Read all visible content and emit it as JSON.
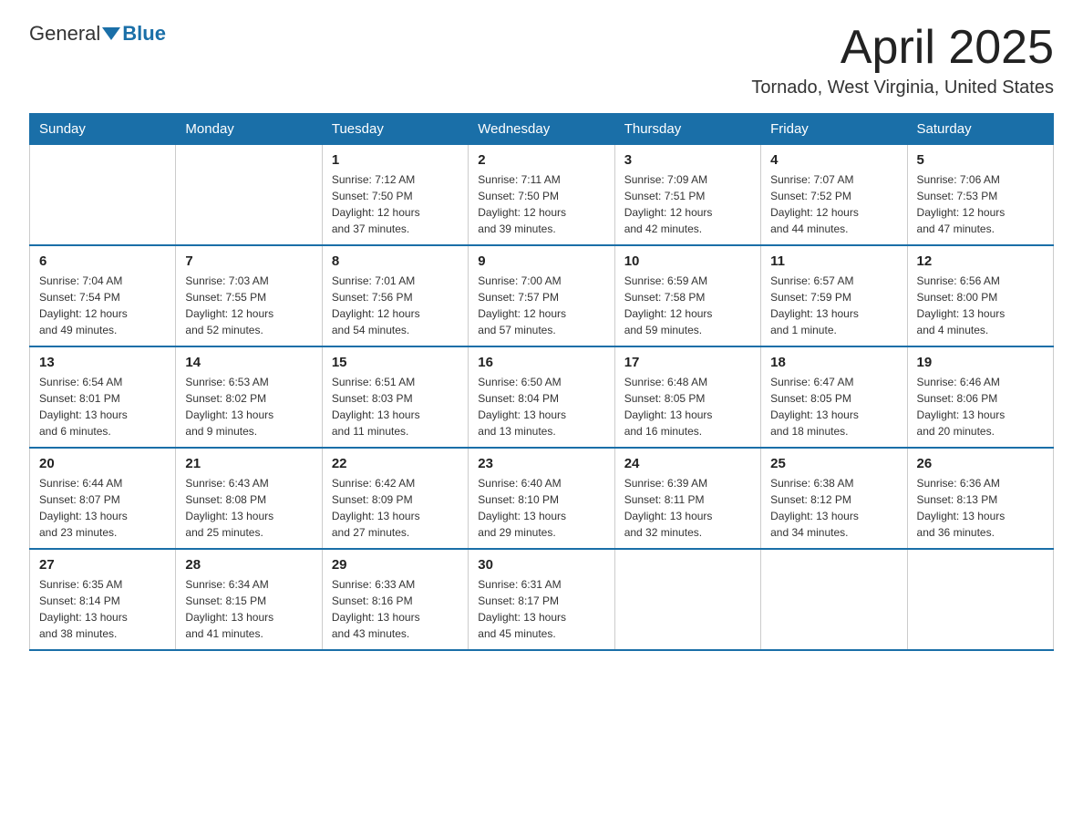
{
  "header": {
    "logo_general": "General",
    "logo_blue": "Blue",
    "month_title": "April 2025",
    "location": "Tornado, West Virginia, United States"
  },
  "weekdays": [
    "Sunday",
    "Monday",
    "Tuesday",
    "Wednesday",
    "Thursday",
    "Friday",
    "Saturday"
  ],
  "weeks": [
    [
      {
        "day": "",
        "info": ""
      },
      {
        "day": "",
        "info": ""
      },
      {
        "day": "1",
        "info": "Sunrise: 7:12 AM\nSunset: 7:50 PM\nDaylight: 12 hours\nand 37 minutes."
      },
      {
        "day": "2",
        "info": "Sunrise: 7:11 AM\nSunset: 7:50 PM\nDaylight: 12 hours\nand 39 minutes."
      },
      {
        "day": "3",
        "info": "Sunrise: 7:09 AM\nSunset: 7:51 PM\nDaylight: 12 hours\nand 42 minutes."
      },
      {
        "day": "4",
        "info": "Sunrise: 7:07 AM\nSunset: 7:52 PM\nDaylight: 12 hours\nand 44 minutes."
      },
      {
        "day": "5",
        "info": "Sunrise: 7:06 AM\nSunset: 7:53 PM\nDaylight: 12 hours\nand 47 minutes."
      }
    ],
    [
      {
        "day": "6",
        "info": "Sunrise: 7:04 AM\nSunset: 7:54 PM\nDaylight: 12 hours\nand 49 minutes."
      },
      {
        "day": "7",
        "info": "Sunrise: 7:03 AM\nSunset: 7:55 PM\nDaylight: 12 hours\nand 52 minutes."
      },
      {
        "day": "8",
        "info": "Sunrise: 7:01 AM\nSunset: 7:56 PM\nDaylight: 12 hours\nand 54 minutes."
      },
      {
        "day": "9",
        "info": "Sunrise: 7:00 AM\nSunset: 7:57 PM\nDaylight: 12 hours\nand 57 minutes."
      },
      {
        "day": "10",
        "info": "Sunrise: 6:59 AM\nSunset: 7:58 PM\nDaylight: 12 hours\nand 59 minutes."
      },
      {
        "day": "11",
        "info": "Sunrise: 6:57 AM\nSunset: 7:59 PM\nDaylight: 13 hours\nand 1 minute."
      },
      {
        "day": "12",
        "info": "Sunrise: 6:56 AM\nSunset: 8:00 PM\nDaylight: 13 hours\nand 4 minutes."
      }
    ],
    [
      {
        "day": "13",
        "info": "Sunrise: 6:54 AM\nSunset: 8:01 PM\nDaylight: 13 hours\nand 6 minutes."
      },
      {
        "day": "14",
        "info": "Sunrise: 6:53 AM\nSunset: 8:02 PM\nDaylight: 13 hours\nand 9 minutes."
      },
      {
        "day": "15",
        "info": "Sunrise: 6:51 AM\nSunset: 8:03 PM\nDaylight: 13 hours\nand 11 minutes."
      },
      {
        "day": "16",
        "info": "Sunrise: 6:50 AM\nSunset: 8:04 PM\nDaylight: 13 hours\nand 13 minutes."
      },
      {
        "day": "17",
        "info": "Sunrise: 6:48 AM\nSunset: 8:05 PM\nDaylight: 13 hours\nand 16 minutes."
      },
      {
        "day": "18",
        "info": "Sunrise: 6:47 AM\nSunset: 8:05 PM\nDaylight: 13 hours\nand 18 minutes."
      },
      {
        "day": "19",
        "info": "Sunrise: 6:46 AM\nSunset: 8:06 PM\nDaylight: 13 hours\nand 20 minutes."
      }
    ],
    [
      {
        "day": "20",
        "info": "Sunrise: 6:44 AM\nSunset: 8:07 PM\nDaylight: 13 hours\nand 23 minutes."
      },
      {
        "day": "21",
        "info": "Sunrise: 6:43 AM\nSunset: 8:08 PM\nDaylight: 13 hours\nand 25 minutes."
      },
      {
        "day": "22",
        "info": "Sunrise: 6:42 AM\nSunset: 8:09 PM\nDaylight: 13 hours\nand 27 minutes."
      },
      {
        "day": "23",
        "info": "Sunrise: 6:40 AM\nSunset: 8:10 PM\nDaylight: 13 hours\nand 29 minutes."
      },
      {
        "day": "24",
        "info": "Sunrise: 6:39 AM\nSunset: 8:11 PM\nDaylight: 13 hours\nand 32 minutes."
      },
      {
        "day": "25",
        "info": "Sunrise: 6:38 AM\nSunset: 8:12 PM\nDaylight: 13 hours\nand 34 minutes."
      },
      {
        "day": "26",
        "info": "Sunrise: 6:36 AM\nSunset: 8:13 PM\nDaylight: 13 hours\nand 36 minutes."
      }
    ],
    [
      {
        "day": "27",
        "info": "Sunrise: 6:35 AM\nSunset: 8:14 PM\nDaylight: 13 hours\nand 38 minutes."
      },
      {
        "day": "28",
        "info": "Sunrise: 6:34 AM\nSunset: 8:15 PM\nDaylight: 13 hours\nand 41 minutes."
      },
      {
        "day": "29",
        "info": "Sunrise: 6:33 AM\nSunset: 8:16 PM\nDaylight: 13 hours\nand 43 minutes."
      },
      {
        "day": "30",
        "info": "Sunrise: 6:31 AM\nSunset: 8:17 PM\nDaylight: 13 hours\nand 45 minutes."
      },
      {
        "day": "",
        "info": ""
      },
      {
        "day": "",
        "info": ""
      },
      {
        "day": "",
        "info": ""
      }
    ]
  ]
}
